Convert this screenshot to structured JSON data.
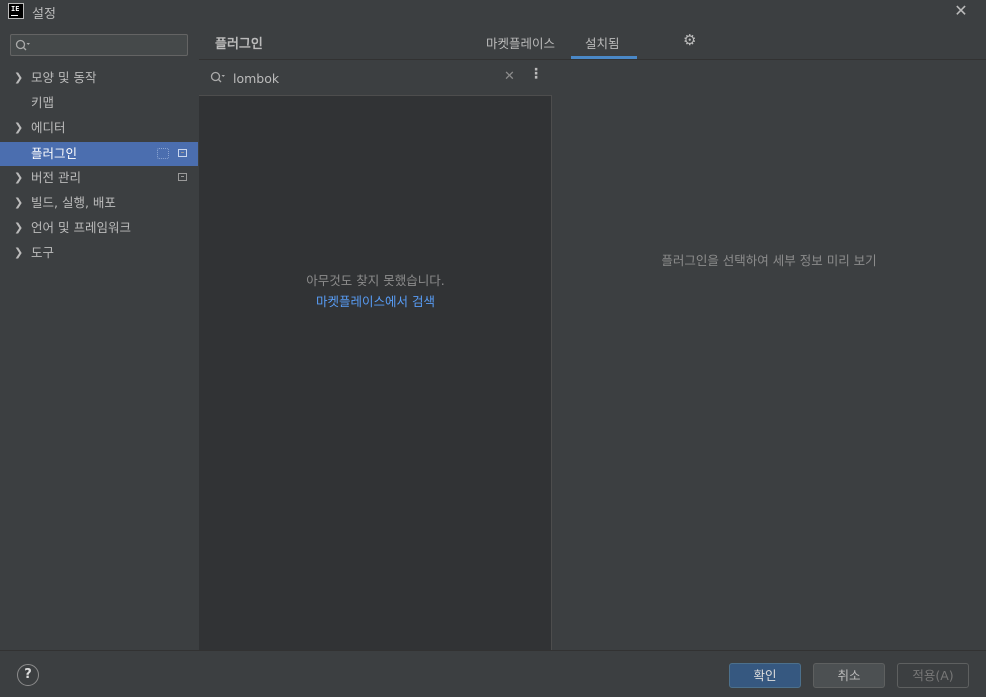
{
  "window": {
    "title": "설정",
    "logo_text": "IE"
  },
  "sidebar": {
    "search_placeholder": "",
    "items": [
      {
        "label": "모양 및 동작",
        "expandable": true
      },
      {
        "label": "키맵",
        "expandable": false
      },
      {
        "label": "에디터",
        "expandable": true
      },
      {
        "label": "플러그인",
        "expandable": false,
        "selected": true
      },
      {
        "label": "버전 관리",
        "expandable": true
      },
      {
        "label": "빌드, 실행, 배포",
        "expandable": true
      },
      {
        "label": "언어 및 프레임워크",
        "expandable": true
      },
      {
        "label": "도구",
        "expandable": true
      }
    ]
  },
  "plugins": {
    "title": "플러그인",
    "tabs": [
      {
        "label": "마켓플레이스",
        "active": false
      },
      {
        "label": "설치됨",
        "active": true
      }
    ],
    "search_value": "lombok",
    "empty_message": "아무것도 찾지 못했습니다.",
    "marketplace_link": "마켓플레이스에서 검색",
    "detail_message": "플러그인을 선택하여 세부 정보 미리 보기"
  },
  "footer": {
    "help": "?",
    "ok": "확인",
    "cancel": "취소",
    "apply": "적용(A)"
  },
  "colors": {
    "background": "#3c3f41",
    "list_background": "#313335",
    "selection": "#4b6eaf",
    "accent": "#4a88c7",
    "link": "#589df6",
    "primary_button": "#365880"
  }
}
